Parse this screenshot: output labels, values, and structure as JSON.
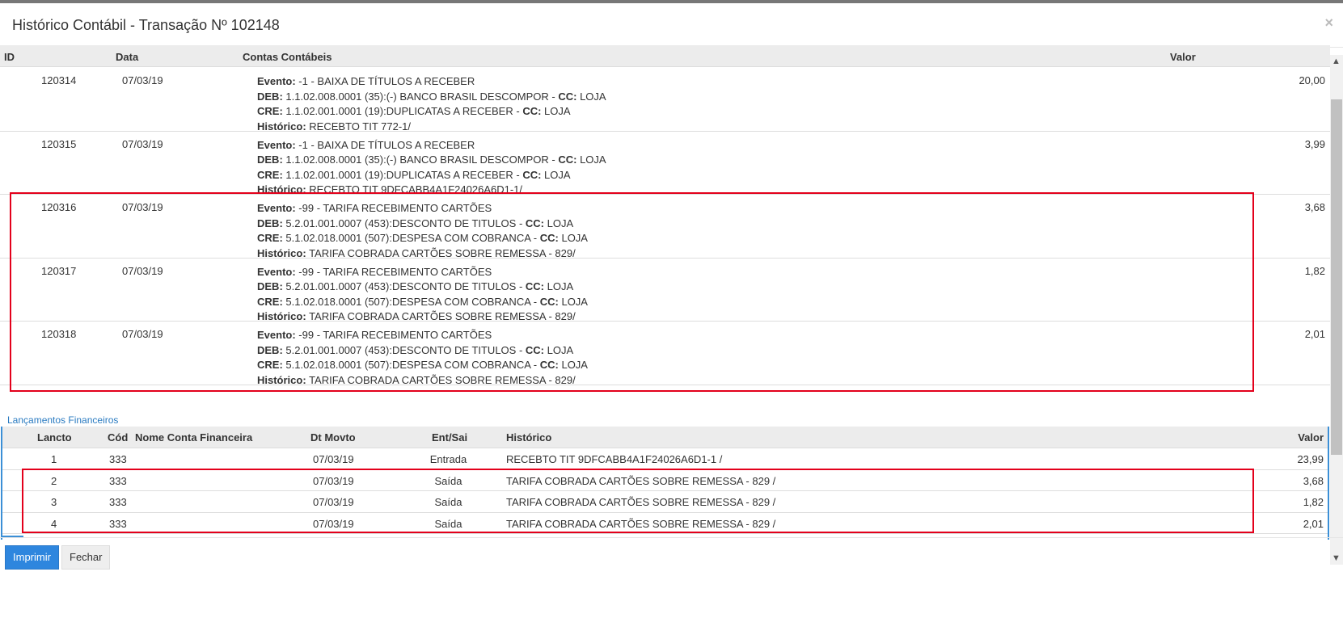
{
  "modal": {
    "title": "Histórico Contábil - Transação Nº 102148",
    "close_glyph": "×"
  },
  "accounting_table": {
    "headers": {
      "id": "ID",
      "date": "Data",
      "accounts": "Contas Contábeis",
      "value": "Valor"
    },
    "labels": {
      "event": "Evento:",
      "deb": "DEB:",
      "cre": "CRE:",
      "cc": "CC:",
      "history": "Histórico:"
    },
    "rows": [
      {
        "id": "120314",
        "date": "07/03/19",
        "value": "20,00",
        "event": "-1 - BAIXA DE TÍTULOS A RECEBER",
        "deb": "1.1.02.008.0001 (35):(-) BANCO BRASIL DESCOMPOR -",
        "deb_cc": "LOJA",
        "cre": "1.1.02.001.0001 (19):DUPLICATAS A RECEBER -",
        "cre_cc": "LOJA",
        "history": "RECEBTO TIT 772-1/"
      },
      {
        "id": "120315",
        "date": "07/03/19",
        "value": "3,99",
        "event": "-1 - BAIXA DE TÍTULOS A RECEBER",
        "deb": "1.1.02.008.0001 (35):(-) BANCO BRASIL DESCOMPOR -",
        "deb_cc": "LOJA",
        "cre": "1.1.02.001.0001 (19):DUPLICATAS A RECEBER -",
        "cre_cc": "LOJA",
        "history": "RECEBTO TIT 9DFCABB4A1F24026A6D1-1/"
      },
      {
        "id": "120316",
        "date": "07/03/19",
        "value": "3,68",
        "event": "-99 - TARIFA RECEBIMENTO CARTÕES",
        "deb": "5.2.01.001.0007 (453):DESCONTO DE TITULOS -",
        "deb_cc": "LOJA",
        "cre": "5.1.02.018.0001 (507):DESPESA COM COBRANCA -",
        "cre_cc": "LOJA",
        "history": "TARIFA COBRADA CARTÕES SOBRE REMESSA - 829/"
      },
      {
        "id": "120317",
        "date": "07/03/19",
        "value": "1,82",
        "event": "-99 - TARIFA RECEBIMENTO CARTÕES",
        "deb": "5.2.01.001.0007 (453):DESCONTO DE TITULOS -",
        "deb_cc": "LOJA",
        "cre": "5.1.02.018.0001 (507):DESPESA COM COBRANCA -",
        "cre_cc": "LOJA",
        "history": "TARIFA COBRADA CARTÕES SOBRE REMESSA - 829/"
      },
      {
        "id": "120318",
        "date": "07/03/19",
        "value": "2,01",
        "event": "-99 - TARIFA RECEBIMENTO CARTÕES",
        "deb": "5.2.01.001.0007 (453):DESCONTO DE TITULOS -",
        "deb_cc": "LOJA",
        "cre": "5.1.02.018.0001 (507):DESPESA COM COBRANCA -",
        "cre_cc": "LOJA",
        "history": "TARIFA COBRADA CARTÕES SOBRE REMESSA - 829/"
      }
    ]
  },
  "financial": {
    "title": "Lançamentos Financeiros",
    "headers": {
      "lancto": "Lancto",
      "cod": "Cód",
      "name": "Nome Conta Financeira",
      "date": "Dt Movto",
      "entsai": "Ent/Sai",
      "history": "Histórico",
      "value": "Valor"
    },
    "rows": [
      {
        "lancto": "1",
        "cod": "333",
        "name": "",
        "date": "07/03/19",
        "entsai": "Entrada",
        "history": "RECEBTO TIT 9DFCABB4A1F24026A6D1-1 /",
        "value": "23,99"
      },
      {
        "lancto": "2",
        "cod": "333",
        "name": "",
        "date": "07/03/19",
        "entsai": "Saída",
        "history": "TARIFA COBRADA CARTÕES SOBRE REMESSA - 829 /",
        "value": "3,68"
      },
      {
        "lancto": "3",
        "cod": "333",
        "name": "",
        "date": "07/03/19",
        "entsai": "Saída",
        "history": "TARIFA COBRADA CARTÕES SOBRE REMESSA - 829 /",
        "value": "1,82"
      },
      {
        "lancto": "4",
        "cod": "333",
        "name": "",
        "date": "07/03/19",
        "entsai": "Saída",
        "history": "TARIFA COBRADA CARTÕES SOBRE REMESSA - 829 /",
        "value": "2,01"
      }
    ]
  },
  "footer": {
    "print_label": "Imprimir",
    "close_label": "Fechar"
  },
  "colors": {
    "highlight": "#e3001b",
    "primary": "#2e86de",
    "link": "#2a7bc1"
  },
  "icons": {
    "scroll_up": "chevron-up-icon",
    "scroll_down": "chevron-down-icon",
    "close": "close-icon"
  }
}
